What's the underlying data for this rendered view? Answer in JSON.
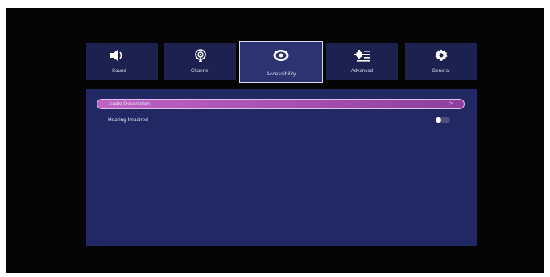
{
  "tabs": [
    {
      "label": "Sound",
      "icon": "speaker-icon",
      "selected": false
    },
    {
      "label": "Channel",
      "icon": "antenna-icon",
      "selected": false
    },
    {
      "label": "Accessibility",
      "icon": "eye-icon",
      "selected": true
    },
    {
      "label": "Advanced",
      "icon": "advanced-settings-icon",
      "selected": false
    },
    {
      "label": "General",
      "icon": "gear-icon",
      "selected": false
    }
  ],
  "menu": {
    "audio_description": {
      "label": "Audio Description",
      "chevron": ">"
    },
    "hearing_impaired": {
      "label": "Hearing Impaired",
      "toggle_on": false
    }
  },
  "colors": {
    "tab_bg": "#1c2150",
    "tab_selected_bg": "#2c3370",
    "panel_bg": "#222864",
    "focus_accent": "#b65abf"
  }
}
